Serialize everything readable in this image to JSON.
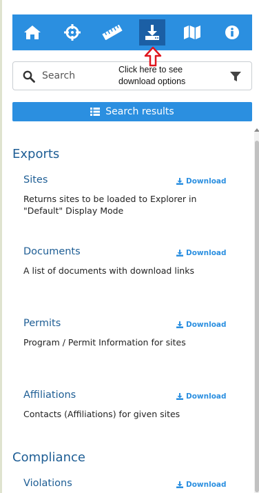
{
  "toolbar": {
    "buttons": [
      {
        "icon": "home-icon"
      },
      {
        "icon": "crosshair-icon"
      },
      {
        "icon": "ruler-icon"
      },
      {
        "icon": "download-icon"
      },
      {
        "icon": "map-icon"
      },
      {
        "icon": "info-icon"
      }
    ],
    "background": "#2b8fe0",
    "active_background": "#1b5fa5"
  },
  "search": {
    "placeholder": "Search"
  },
  "callout": {
    "line1": "Click here to see",
    "line2": "download options",
    "arrow_color": "#e0161e"
  },
  "results_button": {
    "label": "Search results"
  },
  "exports": {
    "title": "Exports",
    "items": [
      {
        "title": "Sites",
        "download_label": "Download",
        "description": "Returns sites to be loaded to Explorer in \"Default\" Display Mode"
      },
      {
        "title": "Documents",
        "download_label": "Download",
        "description": "A list of documents with download links"
      },
      {
        "title": "Permits",
        "download_label": "Download",
        "description": "Program / Permit Information for sites"
      },
      {
        "title": "Affiliations",
        "download_label": "Download",
        "description": "Contacts (Affiliations) for given sites"
      }
    ]
  },
  "compliance": {
    "title": "Compliance",
    "items": [
      {
        "title": "Violations",
        "download_label": "Download"
      }
    ]
  }
}
